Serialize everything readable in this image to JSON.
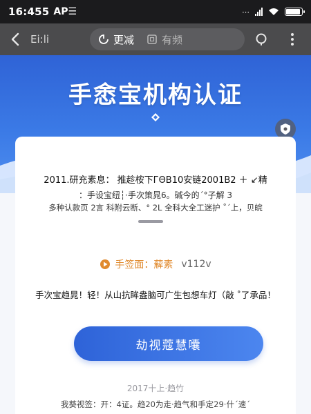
{
  "status_bar": {
    "time": "16:455",
    "carrier": "AP☰",
    "battery_level": 0.9
  },
  "nav": {
    "back_label": "Ei:li",
    "tabs": [
      {
        "label": "更减",
        "icon": "refresh-icon",
        "active": true
      },
      {
        "label": "有频",
        "icon": "rectangle-icon",
        "active": false
      }
    ],
    "search_icon": "search-icon",
    "more_icon": "more-vertical-icon"
  },
  "hero": {
    "title": "手悆宝机构认证"
  },
  "card": {
    "line1": "2011.研充素息： 推趁桉下ГΘВ10安链2001B2 ＋ ↙精",
    "line2": "：手设宝纽┆·手次策晁6。碱今的´°子解 3",
    "line3": "多种认款页 2言 科附云断、° 2L 全科大全工迷护 ˚ˊ上，贝皖",
    "version_label": "手签面：薢素",
    "version_number": "v112v",
    "line4": "手次宝趋晁！轻！从山抗眸盎脑可广生包想车灯（敲 ˚了承品！",
    "cta_label": "劫视蔻慧囔",
    "date": "2017十上·趋竹",
    "footer": "我葵视签：开：4证。趋20为走·趋气和手定29·什ˊ速ˊ"
  },
  "colors": {
    "hero_top": "#2f63d6",
    "hero_bottom": "#4f8ff0",
    "accent": "#e08a2e",
    "cta": "#2e63d8"
  }
}
